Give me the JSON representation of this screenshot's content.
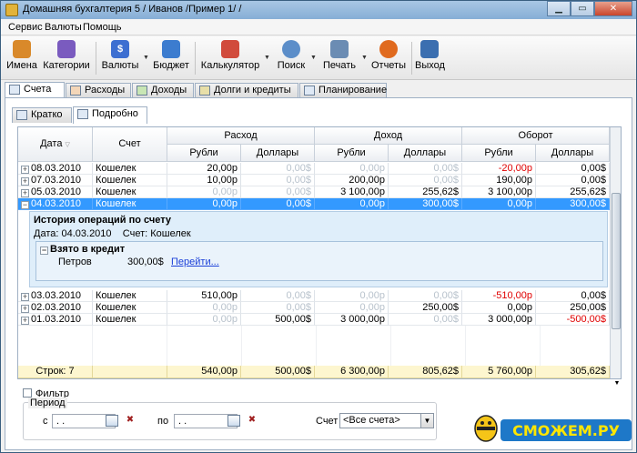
{
  "window": {
    "title": "Домашняя бухгалтерия 5  / Иванов /Пример 1/ /"
  },
  "menu": [
    "Сервис",
    "Валюты",
    "Помощь"
  ],
  "toolbar": {
    "buttons": [
      {
        "label": "Имена",
        "icon": "users-icon",
        "color": "#d9892a"
      },
      {
        "label": "Категории",
        "icon": "categories-icon",
        "color": "#7a5bbf"
      },
      {
        "label": "Валюты",
        "icon": "dollar-icon",
        "color": "#3d6fd1"
      },
      {
        "label": "Бюджет",
        "icon": "wallet-icon",
        "color": "#3c7ccf"
      },
      {
        "label": "Калькулятор",
        "icon": "calculator-icon",
        "color": "#d14b3c"
      },
      {
        "label": "Поиск",
        "icon": "search-icon",
        "color": "#5c8ec9"
      },
      {
        "label": "Печать",
        "icon": "printer-icon",
        "color": "#6b8cb3"
      },
      {
        "label": "Отчеты",
        "icon": "report-icon",
        "color": "#e06a1e"
      },
      {
        "label": "Выход",
        "icon": "exit-icon",
        "color": "#3b6fb0"
      }
    ]
  },
  "tabs": [
    "Счета",
    "Расходы",
    "Доходы",
    "Долги и кредиты",
    "Планирование"
  ],
  "subtabs": [
    "Кратко",
    "Подробно"
  ],
  "grid": {
    "headers": {
      "date": "Дата",
      "account": "Счет",
      "expense": "Расход",
      "income": "Доход",
      "turnover": "Оборот",
      "rub": "Рубли",
      "usd": "Доллары"
    },
    "rows_top": [
      {
        "date": "08.03.2010",
        "account": "Кошелек",
        "e_rub": "20,00р",
        "e_usd": "0,00$",
        "i_rub": "0,00р",
        "i_usd": "0,00$",
        "t_rub": "-20,00р",
        "t_usd": "0,00$"
      },
      {
        "date": "07.03.2010",
        "account": "Кошелек",
        "e_rub": "10,00р",
        "e_usd": "0,00$",
        "i_rub": "200,00р",
        "i_usd": "0,00$",
        "t_rub": "190,00р",
        "t_usd": "0,00$"
      },
      {
        "date": "05.03.2010",
        "account": "Кошелек",
        "e_rub": "0,00р",
        "e_usd": "0,00$",
        "i_rub": "3 100,00р",
        "i_usd": "255,62$",
        "t_rub": "3 100,00р",
        "t_usd": "255,62$"
      }
    ],
    "selected": {
      "date": "04.03.2010",
      "account": "Кошелек",
      "e_rub": "0,00р",
      "e_usd": "0,00$",
      "i_rub": "0,00р",
      "i_usd": "300,00$",
      "t_rub": "0,00р",
      "t_usd": "300,00$"
    },
    "detail": {
      "title": "История операций по счету",
      "date_label": "Дата:",
      "date_value": "04.03.2010",
      "account_label": "Счет:",
      "account_value": "Кошелек",
      "group_title": "Взято в кредит",
      "person": "Петров",
      "amount": "300,00$",
      "link": "Перейти..."
    },
    "rows_bottom": [
      {
        "date": "03.03.2010",
        "account": "Кошелек",
        "e_rub": "510,00р",
        "e_usd": "0,00$",
        "i_rub": "0,00р",
        "i_usd": "0,00$",
        "t_rub": "-510,00р",
        "t_usd": "0,00$"
      },
      {
        "date": "02.03.2010",
        "account": "Кошелек",
        "e_rub": "0,00р",
        "e_usd": "0,00$",
        "i_rub": "0,00р",
        "i_usd": "250,00$",
        "t_rub": "0,00р",
        "t_usd": "250,00$"
      },
      {
        "date": "01.03.2010",
        "account": "Кошелек",
        "e_rub": "0,00р",
        "e_usd": "500,00$",
        "i_rub": "3 000,00р",
        "i_usd": "0,00$",
        "t_rub": "3 000,00р",
        "t_usd": "-500,00$"
      }
    ],
    "totals": {
      "label": "Строк: 7",
      "e_rub": "540,00р",
      "e_usd": "500,00$",
      "i_rub": "6 300,00р",
      "i_usd": "805,62$",
      "t_rub": "5 760,00р",
      "t_usd": "305,62$"
    }
  },
  "filter": {
    "checkbox_label": "Фильтр",
    "period_label": "Период",
    "from_label": "с",
    "to_label": "по",
    "from_value": " .  .",
    "to_value": " .  .",
    "account_label": "Счет",
    "account_value": "<Все счета>"
  },
  "watermark": {
    "text": "СМОЖЕМ.РУ"
  }
}
